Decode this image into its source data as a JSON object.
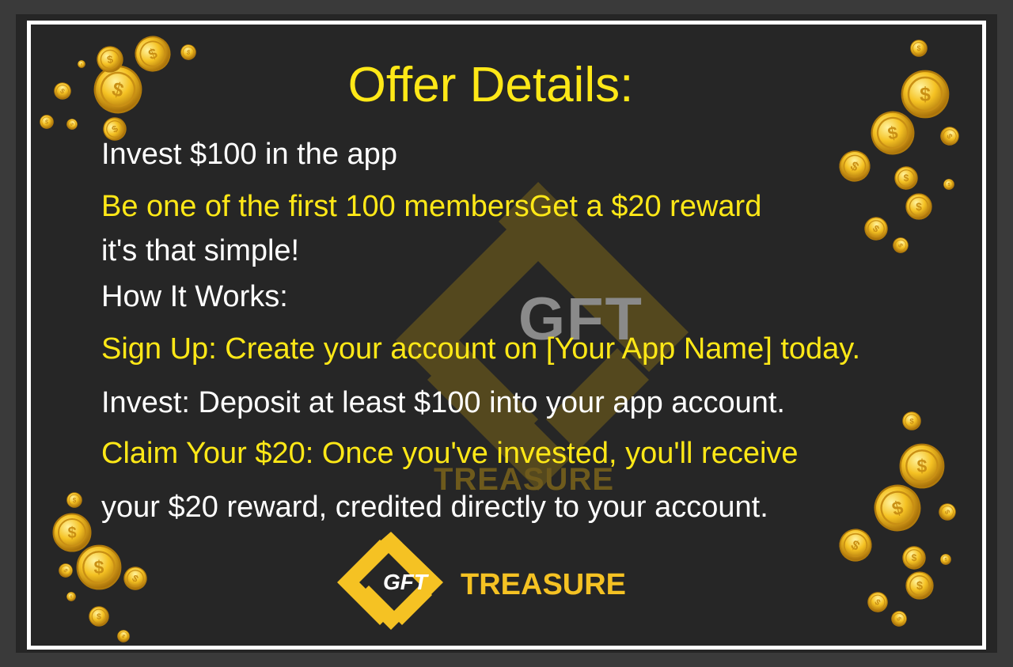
{
  "title": "Offer Details:",
  "lines": [
    "Invest $100 in the app",
    "Be one of the first 100 membersGet a $20 reward",
    "it's that simple!",
    "How It Works:",
    "Sign Up: Create your account on [Your App Name] today.",
    "Invest: Deposit at least $100 into your app account.",
    "Claim Your $20: Once you've invested, you'll receive",
    "your $20 reward, credited directly to your account."
  ],
  "watermark": {
    "logo_text": "GFT",
    "brand": "TREASURE"
  },
  "footer": {
    "logo_text": "GFT",
    "brand": "TREASURE"
  },
  "colors": {
    "background": "#262626",
    "frame": "#ffffff",
    "highlight": "#ffe817",
    "body_text": "#ffffff",
    "gold": "#f5c223"
  },
  "icons": [
    "gold-coin-icon",
    "gft-diamond-logo-icon"
  ]
}
